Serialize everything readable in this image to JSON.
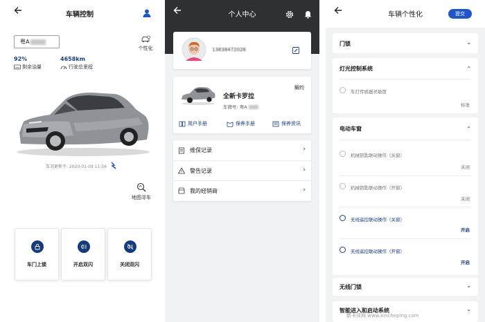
{
  "panel1": {
    "title": "车辆控制",
    "plate": "粤A",
    "fuel_value": "92%",
    "fuel_label": "剩余油量",
    "mileage_value": "4658km",
    "mileage_label": "行驶总里程",
    "personalize_label": "个性化",
    "update_time": "车况更新于: 2020-01-09 11:56",
    "map_label": "地图寻车",
    "tiles": [
      {
        "label": "车门上锁",
        "icon": "lock-icon"
      },
      {
        "label": "开启双闪",
        "icon": "hazard-on-icon"
      },
      {
        "label": "关闭双闪",
        "icon": "hazard-off-icon"
      }
    ]
  },
  "panel2": {
    "title": "个人中心",
    "phone": "13838472026",
    "car_name": "全新卡罗拉",
    "unbind": "解约",
    "plate_label": "车牌号: 粤A",
    "plate_tail": "",
    "actions": [
      {
        "label": "用户手册"
      },
      {
        "label": "保养手册"
      },
      {
        "label": "保养资讯"
      }
    ],
    "menu": [
      {
        "label": "维保记录"
      },
      {
        "label": "警告记录"
      },
      {
        "label": "我的经销商"
      }
    ]
  },
  "panel3": {
    "title": "车辆个性化",
    "submit": "提交",
    "sections": {
      "door": "门锁",
      "light": "灯光控制系统",
      "light_opt": "车灯传感器灵敏度",
      "light_val": "标准",
      "window": "电动车窗",
      "w1": "机械钥匙联动操作（关窗）",
      "w1v": "关闭",
      "w2": "机械钥匙联动操作（开窗）",
      "w2v": "关闭",
      "w3": "无线遥控联动操作（关窗）",
      "w3v": "开启",
      "w4": "无线遥控联动操作（开窗）",
      "w4v": "开启",
      "wireless": "无线门锁",
      "smart": "智能进入和启动系统"
    },
    "watermark": "新卡评网 www.xincheping.com"
  },
  "colors": {
    "brand": "#1a3f82",
    "dark_header": "#2f3034",
    "accent_blue": "#1f55c7"
  }
}
